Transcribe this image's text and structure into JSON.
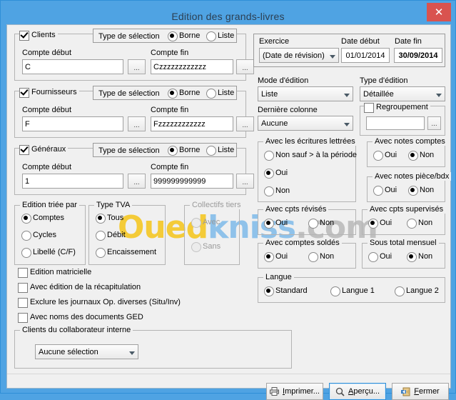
{
  "window": {
    "title": "Edition des grands-livres",
    "close_icon": "close-icon",
    "accent": "#4fa3e3",
    "close_color": "#d9534f"
  },
  "watermark": {
    "part1": "Oued",
    "part2": "kniss",
    "part3": ".com"
  },
  "tiers_groups": [
    {
      "key": "clients",
      "title": "Clients",
      "checked": true,
      "selection_label": "Type de sélection",
      "opt_borne": "Borne",
      "opt_liste": "Liste",
      "selection_value": "Borne",
      "start_label": "Compte début",
      "end_label": "Compte fin",
      "start_value": "C",
      "end_value": "Czzzzzzzzzzzz",
      "browse_label": "..."
    },
    {
      "key": "fournisseurs",
      "title": "Fournisseurs",
      "checked": true,
      "selection_label": "Type de sélection",
      "opt_borne": "Borne",
      "opt_liste": "Liste",
      "selection_value": "Borne",
      "start_label": "Compte début",
      "end_label": "Compte fin",
      "start_value": "F",
      "end_value": "Fzzzzzzzzzzzz",
      "browse_label": "..."
    },
    {
      "key": "generaux",
      "title": "Généraux",
      "checked": true,
      "selection_label": "Type de sélection",
      "opt_borne": "Borne",
      "opt_liste": "Liste",
      "selection_value": "Borne",
      "start_label": "Compte début",
      "end_label": "Compte fin",
      "start_value": "1",
      "end_value": "999999999999",
      "browse_label": "..."
    }
  ],
  "edition_triee": {
    "title": "Edition triée par",
    "options": [
      "Comptes",
      "Cycles",
      "Libellé (C/F)"
    ],
    "selected": "Comptes"
  },
  "type_tva": {
    "title": "Type TVA",
    "options": [
      "Tous",
      "Débit",
      "Encaissement"
    ],
    "selected": "Tous"
  },
  "collectifs_tiers": {
    "title": "Collectifs tiers",
    "options": [
      "Avec",
      "Sans"
    ],
    "selected": "",
    "disabled": true
  },
  "checkboxes": [
    {
      "label": "Edition matricielle",
      "checked": false
    },
    {
      "label": "Avec édition de la récapitulation",
      "checked": false
    },
    {
      "label": "Exclure les journaux Op. diverses (Situ/Inv)",
      "checked": false
    },
    {
      "label": "Avec noms des documents GED",
      "checked": false
    }
  ],
  "collaborateur": {
    "title": "Clients du collaborateur interne",
    "selected": "Aucune sélection"
  },
  "exercice": {
    "label": "Exercice",
    "value": "(Date de révision)",
    "date_debut_label": "Date début",
    "date_debut": "01/01/2014",
    "date_fin_label": "Date fin",
    "date_fin": "30/09/2014"
  },
  "mode_edition": {
    "label": "Mode d'édition",
    "value": "Liste"
  },
  "type_edition": {
    "label": "Type d'édition",
    "value": "Détaillée"
  },
  "derniere_colonne": {
    "label": "Dernière colonne",
    "value": "Aucune"
  },
  "regroupement": {
    "label": "Regroupement",
    "checked": false,
    "value": "",
    "browse_label": "..."
  },
  "ecritures_lettrees": {
    "title": "Avec les écritures lettrées",
    "options": [
      "Non sauf > à la période",
      "Oui",
      "Non"
    ],
    "selected": "Oui"
  },
  "notes_comptes": {
    "title": "Avec notes comptes",
    "options": [
      "Oui",
      "Non"
    ],
    "selected": "Non"
  },
  "notes_piece": {
    "title": "Avec notes pièce/bdx",
    "options": [
      "Oui",
      "Non"
    ],
    "selected": "Non"
  },
  "cpts_revises": {
    "title": "Avec cpts révisés",
    "options": [
      "Oui",
      "Non"
    ],
    "selected": "Oui"
  },
  "cpts_supervises": {
    "title": "Avec cpts supervisés",
    "options": [
      "Oui",
      "Non"
    ],
    "selected": "Oui"
  },
  "comptes_soldes": {
    "title": "Avec comptes soldés",
    "options": [
      "Oui",
      "Non"
    ],
    "selected": "Oui"
  },
  "sous_total": {
    "title": "Sous total mensuel",
    "options": [
      "Oui",
      "Non"
    ],
    "selected": "Non"
  },
  "langue": {
    "title": "Langue",
    "options": [
      "Standard",
      "Langue 1",
      "Langue 2"
    ],
    "selected": "Standard"
  },
  "footer": {
    "print": "Imprimer...",
    "print_icon": "printer-icon",
    "preview": "Aperçu...",
    "preview_icon": "magnifier-icon",
    "close": "Fermer",
    "close_icon": "exit-door-icon"
  }
}
